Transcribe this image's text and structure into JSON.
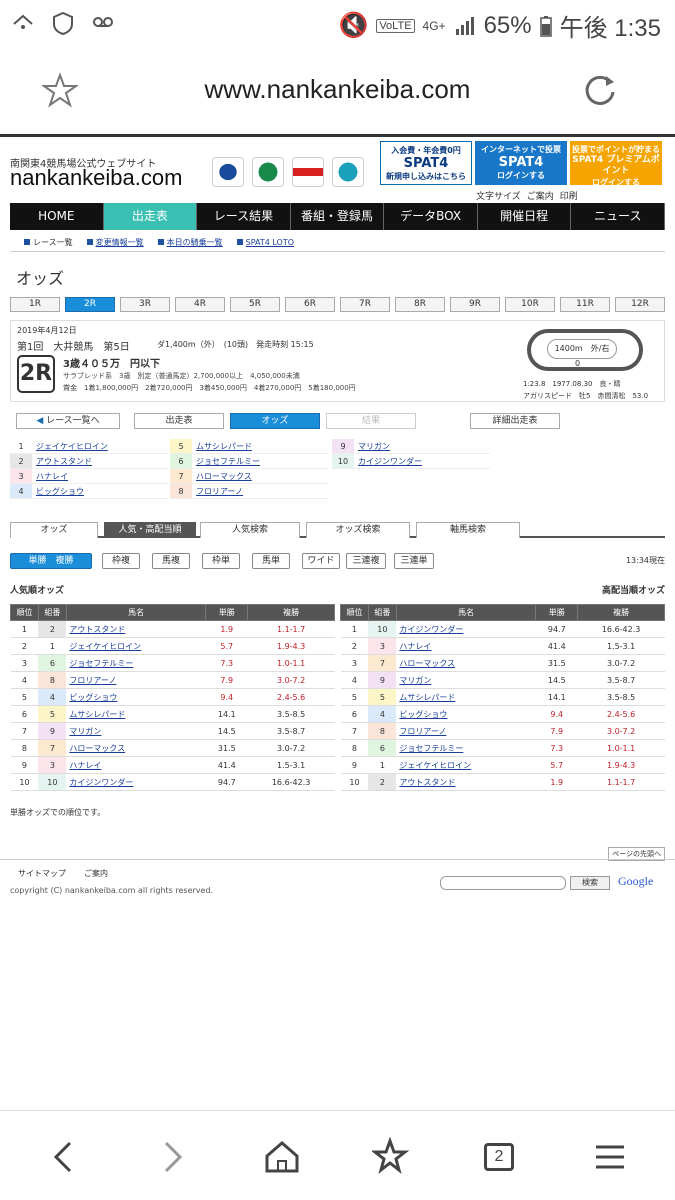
{
  "status": {
    "time": "午後 1:35",
    "battery": "65%",
    "volte": "VoLTE",
    "net": "4G+"
  },
  "browser": {
    "url": "www.nankankeiba.com",
    "tab_count": "2"
  },
  "site": {
    "brand_small": "南関東4競馬場公式ウェブサイト",
    "brand": "nankankeiba.com",
    "banners": [
      {
        "l1": "入会費・年会費0円",
        "l2": "SPAT4",
        "l3": "新規申し込みはこちら"
      },
      {
        "l1": "インターネットで投票",
        "l2": "SPAT4",
        "l3": "ログインする"
      },
      {
        "l1": "投票でポイントが貯まる",
        "l2": "SPAT4 プレミアムポイント",
        "l3": "ログインする"
      }
    ],
    "util": [
      "文字サイズ",
      "ご案内",
      "印刷"
    ]
  },
  "nav": [
    "HOME",
    "出走表",
    "レース結果",
    "番組・登録馬",
    "データBOX",
    "開催日程",
    "ニュース"
  ],
  "subnav": [
    "レース一覧",
    "変更情報一覧",
    "本日の騎乗一覧",
    "SPAT4 LOTO"
  ],
  "page_title": "オッズ",
  "race_tabs": [
    "1R",
    "2R",
    "3R",
    "4R",
    "5R",
    "6R",
    "7R",
    "8R",
    "9R",
    "10R",
    "11R",
    "12R"
  ],
  "race": {
    "date": "2019年4月12日",
    "meet": "第1回　大井競馬　第5日",
    "dist": "ダ1,400m（外）　(10頭)　発走時刻 15:15",
    "number": "2R",
    "class": "3歳４０５万　円以下",
    "line1": "サラブレッド系　3歳　別定（普通馬定）2,700,000以上　4,050,000未満",
    "line2": "賞金　1着1,800,000円　2着720,000円　3着450,000円　4着270,000円　5着180,000円",
    "track": "1400m　外/右",
    "record1": "1:23.8　1977.08.30　良・晴",
    "record2": "アガリスピード　牡5　赤間清松　53.0",
    "track_zero": "0"
  },
  "buttons": {
    "back": "レース一覧へ",
    "entries": "出走表",
    "odds": "オッズ",
    "result": "結果",
    "detail": "詳細出走表"
  },
  "horses": [
    {
      "no": "1",
      "name": "ジェイケイヒロイン"
    },
    {
      "no": "2",
      "name": "アウトスタンド"
    },
    {
      "no": "3",
      "name": "ハナレイ"
    },
    {
      "no": "4",
      "name": "ビッグショウ"
    },
    {
      "no": "5",
      "name": "ムサシレパード"
    },
    {
      "no": "6",
      "name": "ジョセフテルミー"
    },
    {
      "no": "7",
      "name": "ハローマックス"
    },
    {
      "no": "8",
      "name": "フロリアーノ"
    },
    {
      "no": "9",
      "name": "マリガン"
    },
    {
      "no": "10",
      "name": "カイジンワンダー"
    }
  ],
  "section_tabs": [
    "オッズ",
    "人気・高配当順",
    "人気検索",
    "オッズ検索",
    "軸馬検索"
  ],
  "bet_types": [
    "単勝　複勝",
    "枠複",
    "馬複",
    "枠単",
    "馬単",
    "ワイド",
    "三連複",
    "三連単"
  ],
  "as_of": "13:34現在",
  "table_titles": {
    "left": "人気順オッズ",
    "right": "高配当順オッズ"
  },
  "columns": [
    "順位",
    "組番",
    "馬名",
    "単勝",
    "複勝"
  ],
  "popular": [
    [
      "1",
      "2",
      "アウトスタンド",
      "1.9",
      "1.1-1.7"
    ],
    [
      "2",
      "1",
      "ジェイケイヒロイン",
      "5.7",
      "1.9-4.3"
    ],
    [
      "3",
      "6",
      "ジョセフテルミー",
      "7.3",
      "1.0-1.1"
    ],
    [
      "4",
      "8",
      "フロリアーノ",
      "7.9",
      "3.0-7.2"
    ],
    [
      "5",
      "4",
      "ビッグショウ",
      "9.4",
      "2.4-5.6"
    ],
    [
      "6",
      "5",
      "ムサシレパード",
      "14.1",
      "3.5-8.5"
    ],
    [
      "7",
      "9",
      "マリガン",
      "14.5",
      "3.5-8.7"
    ],
    [
      "8",
      "7",
      "ハローマックス",
      "31.5",
      "3.0-7.2"
    ],
    [
      "9",
      "3",
      "ハナレイ",
      "41.4",
      "1.5-3.1"
    ],
    [
      "10",
      "10",
      "カイジンワンダー",
      "94.7",
      "16.6-42.3"
    ]
  ],
  "high": [
    [
      "1",
      "10",
      "カイジンワンダー",
      "94.7",
      "16.6-42.3"
    ],
    [
      "2",
      "3",
      "ハナレイ",
      "41.4",
      "1.5-3.1"
    ],
    [
      "3",
      "7",
      "ハローマックス",
      "31.5",
      "3.0-7.2"
    ],
    [
      "4",
      "9",
      "マリガン",
      "14.5",
      "3.5-8.7"
    ],
    [
      "5",
      "5",
      "ムサシレパード",
      "14.1",
      "3.5-8.5"
    ],
    [
      "6",
      "4",
      "ビッグショウ",
      "9.4",
      "2.4-5.6"
    ],
    [
      "7",
      "8",
      "フロリアーノ",
      "7.9",
      "3.0-7.2"
    ],
    [
      "8",
      "6",
      "ジョセフテルミー",
      "7.3",
      "1.0-1.1"
    ],
    [
      "9",
      "1",
      "ジェイケイヒロイン",
      "5.7",
      "1.9-4.3"
    ],
    [
      "10",
      "2",
      "アウトスタンド",
      "1.9",
      "1.1-1.7"
    ]
  ],
  "note": "単勝オッズでの順位です。",
  "pagetop": "ページの先頭へ",
  "footer": {
    "links": [
      "サイトマップ",
      "ご案内"
    ],
    "copyright": "copyright (C) nankankeiba.com all rights reserved.",
    "search_btn": "検索",
    "google": "Google"
  }
}
